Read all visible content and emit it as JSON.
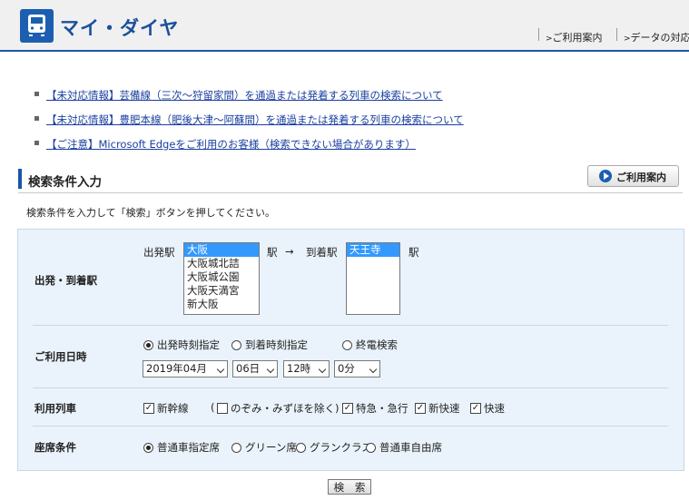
{
  "header": {
    "logo_icon": "train-icon",
    "title": "マイ・ダイヤ",
    "links": [
      "ご利用案内",
      "データの対応"
    ]
  },
  "notices": [
    "【未対応情報】芸備線（三次～狩留家間）を通過または発着する列車の検索について",
    "【未対応情報】豊肥本線（肥後大津～阿蘇間）を通過または発着する列車の検索について",
    "【ご注意】Microsoft Edgeをご利用のお客様（検索できない場合があります）"
  ],
  "section": {
    "title": "検索条件入力",
    "guide_button": "ご利用案内",
    "instruction": "検索条件を入力して「検索」ボタンを押してください。"
  },
  "form": {
    "station": {
      "label": "出発・到着駅",
      "from_label": "出発駅",
      "from_options": [
        "大阪",
        "大阪城北詰",
        "大阪城公園",
        "大阪天満宮",
        "新大阪"
      ],
      "from_selected": "大阪",
      "station_suffix": "駅",
      "arrow": "→",
      "to_label": "到着駅",
      "to_options": [
        "天王寺"
      ],
      "to_selected": "天王寺"
    },
    "datetime": {
      "label": "ご利用日時",
      "modes": [
        "出発時刻指定",
        "到着時刻指定",
        "終電検索"
      ],
      "selected_mode": "出発時刻指定",
      "year_month": "2019年04月",
      "day": "06日",
      "hour": "12時",
      "minute": "0分"
    },
    "trains": {
      "label": "利用列車",
      "shinkansen": "新幹線",
      "paren_open": "(",
      "exclude": "のぞみ・みずほを除く)",
      "tokkyu": "特急・急行",
      "shinkaisoku": "新快速",
      "kaisoku": "快速",
      "checked": [
        "新幹線",
        "特急・急行",
        "新快速",
        "快速"
      ]
    },
    "seat": {
      "label": "座席条件",
      "options": [
        "普通車指定席",
        "グリーン席",
        "グランクラス",
        "普通車自由席"
      ],
      "selected": "普通車指定席"
    }
  },
  "search_button": "検 索"
}
